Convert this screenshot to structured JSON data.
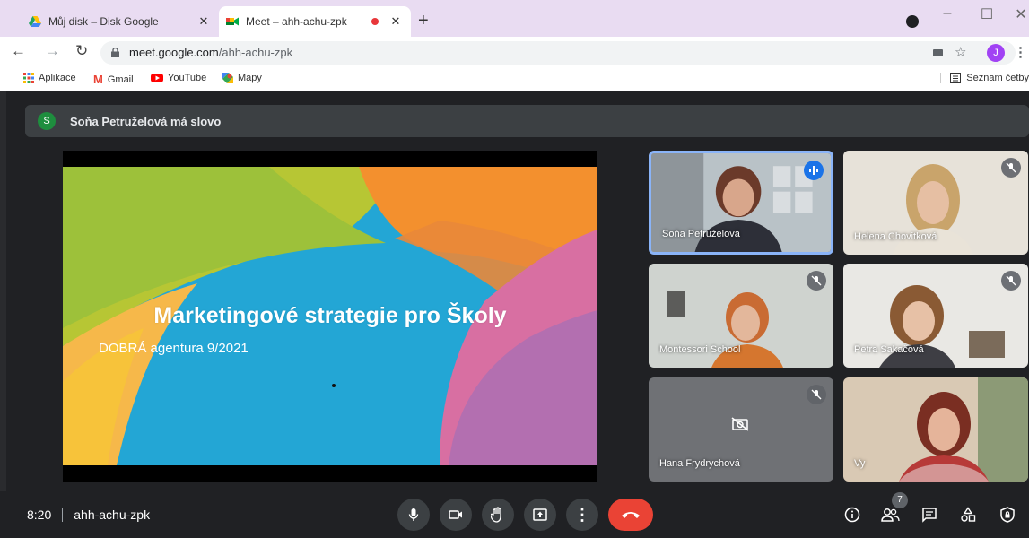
{
  "browser": {
    "tabs": [
      {
        "title": "Můj disk – Disk Google",
        "icon": "google-drive-icon"
      },
      {
        "title": "Meet – ahh-achu-zpk",
        "icon": "google-meet-icon",
        "recording": true
      }
    ],
    "url_host": "meet.google.com",
    "url_path": "/ahh-achu-zpk",
    "profile_initial": "J",
    "bookmarks": [
      {
        "label": "Aplikace",
        "icon": "apps-grid-icon"
      },
      {
        "label": "Gmail",
        "icon": "gmail-icon"
      },
      {
        "label": "YouTube",
        "icon": "youtube-icon"
      },
      {
        "label": "Mapy",
        "icon": "maps-icon"
      }
    ],
    "reading_list": "Seznam četby"
  },
  "meet": {
    "speaker_initial": "S",
    "speaker_banner": "Soňa Petruželová má slovo",
    "slide": {
      "title": "Marketingové strategie pro Školy",
      "subtitle": "DOBRÁ agentura 9/2021"
    },
    "participants": [
      {
        "name": "Soňa Petruželová",
        "state": "speaking"
      },
      {
        "name": "Helena Chovitková",
        "state": "muted"
      },
      {
        "name": "Montessori School",
        "state": "muted"
      },
      {
        "name": "Petra Sakačová",
        "state": "muted"
      },
      {
        "name": "Hana Frydrychová",
        "state": "muted-camera-off"
      },
      {
        "name": "Vy",
        "state": "self"
      }
    ],
    "time": "8:20",
    "meeting_code": "ahh-achu-zpk",
    "participant_count": "7",
    "colors": {
      "hangup": "#ea4335",
      "speaking": "#1a73e8",
      "bar": "#202124"
    }
  }
}
